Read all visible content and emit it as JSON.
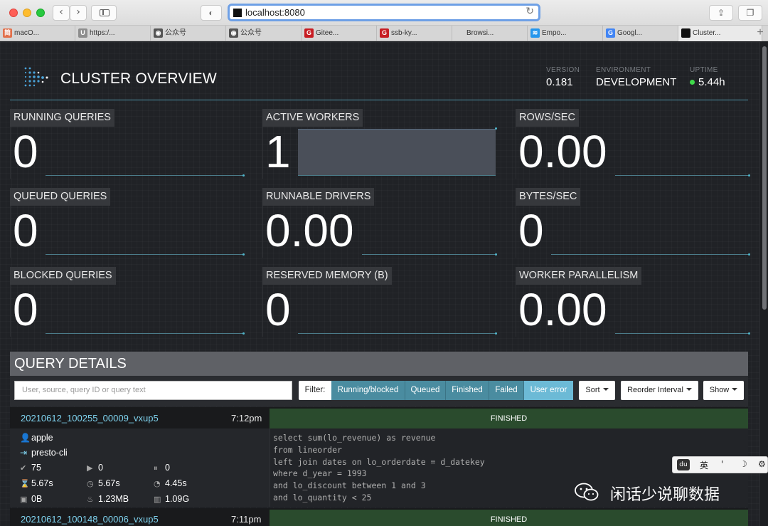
{
  "browser": {
    "url": "localhost:8080",
    "tabs": [
      {
        "label": "macO...",
        "icon": "简",
        "color": "#e2704b"
      },
      {
        "label": "https:/...",
        "icon": "U",
        "color": "#8e8e8e"
      },
      {
        "label": "公众号",
        "icon": "◉",
        "color": "#555555"
      },
      {
        "label": "公众号",
        "icon": "◉",
        "color": "#555555"
      },
      {
        "label": "Gitee...",
        "icon": "G",
        "color": "#c71d23"
      },
      {
        "label": "ssb-ky...",
        "icon": "G",
        "color": "#c71d23"
      },
      {
        "label": "Browsi...",
        "icon": "",
        "color": "#d6d6d6"
      },
      {
        "label": "Empo...",
        "icon": "≋",
        "color": "#2496ed"
      },
      {
        "label": "Googl...",
        "icon": "G",
        "color": "#4285f4"
      },
      {
        "label": "Cluster...",
        "icon": "",
        "color": "#111111"
      }
    ],
    "new_tab_glyph": "+"
  },
  "header": {
    "title": "CLUSTER OVERVIEW",
    "version_label": "VERSION",
    "version": "0.181",
    "environment_label": "ENVIRONMENT",
    "environment": "DEVELOPMENT",
    "uptime_label": "UPTIME",
    "uptime": "5.44h",
    "uptime_status_color": "#3fd94a"
  },
  "stats": [
    {
      "label": "RUNNING QUERIES",
      "value": "0"
    },
    {
      "label": "ACTIVE WORKERS",
      "value": "1"
    },
    {
      "label": "ROWS/SEC",
      "value": "0.00"
    },
    {
      "label": "QUEUED QUERIES",
      "value": "0"
    },
    {
      "label": "RUNNABLE DRIVERS",
      "value": "0.00"
    },
    {
      "label": "BYTES/SEC",
      "value": "0"
    },
    {
      "label": "BLOCKED QUERIES",
      "value": "0"
    },
    {
      "label": "RESERVED MEMORY (B)",
      "value": "0"
    },
    {
      "label": "WORKER PARALLELISM",
      "value": "0.00"
    }
  ],
  "query_details": {
    "title": "QUERY DETAILS",
    "search_placeholder": "User, source, query ID or query text",
    "filter_label": "Filter:",
    "filters": [
      "Running/blocked",
      "Queued",
      "Finished",
      "Failed",
      "User error"
    ],
    "sort_label": "Sort",
    "reorder_label": "Reorder Interval",
    "show_label": "Show"
  },
  "queries": [
    {
      "id": "20210612_100255_00009_vxup5",
      "time": "7:12pm",
      "state": "FINISHED",
      "user": "apple",
      "source": "presto-cli",
      "completed_splits": "75",
      "running_splits": "0",
      "queued_splits": "0",
      "wall_time": "5.67s",
      "elapsed_time": "5.67s",
      "cpu_time": "4.45s",
      "current_memory": "0B",
      "peak_memory": "1.23MB",
      "cumulative_memory": "1.09G",
      "sql": [
        "select sum(lo_revenue) as revenue",
        "from lineorder",
        "left join dates on lo_orderdate = d_datekey",
        "where d_year = 1993",
        "and lo_discount between 1 and 3",
        "and lo_quantity < 25"
      ]
    },
    {
      "id": "20210612_100148_00006_vxup5",
      "time": "7:11pm",
      "state": "FINISHED"
    }
  ],
  "ime": {
    "logo": "du",
    "lang": "英",
    "punct": "'",
    "mode": "☽",
    "settings": "⚙"
  },
  "watermark": {
    "text": "闲话少说聊数据"
  }
}
